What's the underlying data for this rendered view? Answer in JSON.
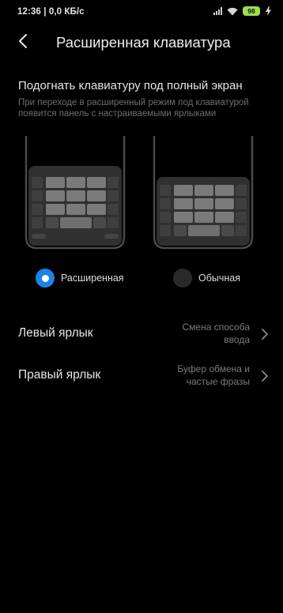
{
  "status_bar": {
    "time_speed": "12:36 | 0,0 КБ/с",
    "battery": "98",
    "icons": [
      "signal-icon",
      "wifi-icon",
      "battery-icon",
      "charging-icon"
    ],
    "battery_color": "#9be04f"
  },
  "header": {
    "title": "Расширенная клавиатура",
    "back_icon": "back-arrow-icon"
  },
  "section": {
    "title": "Подогнать клавиатуру под полный экран",
    "description": "При переходе в расширенный режим под клавиатурой появится панель с настраиваемыми ярлыками"
  },
  "options": [
    {
      "label": "Расширенная",
      "selected": true
    },
    {
      "label": "Обычная",
      "selected": false
    }
  ],
  "rows": [
    {
      "label": "Левый ярлык",
      "value": "Смена способа ввода"
    },
    {
      "label": "Правый ярлык",
      "value": "Буфер обмена и частые фразы"
    }
  ],
  "colors": {
    "background": "#000000",
    "accent": "#1a84e6",
    "secondary_text": "#7c7c7c"
  }
}
